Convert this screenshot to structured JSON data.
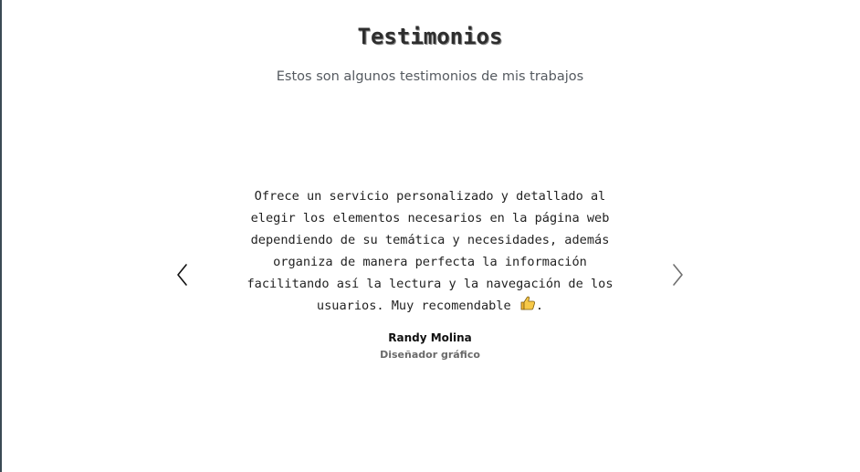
{
  "testimonials": {
    "title": "Testimonios",
    "subtitle": "Estos son algunos testimonios de mis trabajos",
    "current": {
      "quote": "Ofrece un servicio personalizado y detallado al elegir los elementos necesarios en la página web dependiendo de su temática y necesidades, además organiza de manera perfecta la información facilitando así la lectura y la navegación de los usuarios. Muy recomendable",
      "emoji_icon": "thumbs-up-icon",
      "quote_end": ".",
      "author": "Randy Molina",
      "role": "Diseñador gráfico"
    },
    "controls": {
      "prev_icon": "chevron-left-icon",
      "next_icon": "chevron-right-icon"
    }
  },
  "colors": {
    "title": "#2e2e2e",
    "subtitle": "#555a60",
    "text": "#222222",
    "role": "#6a6a6a",
    "thumbs": "#f2b632"
  }
}
